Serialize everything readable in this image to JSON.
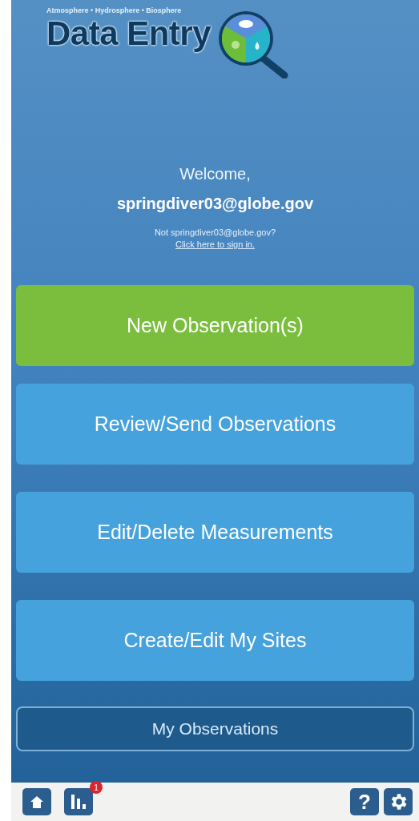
{
  "header": {
    "tagline": "Atmosphere • Hydrosphere • Biosphere",
    "title": "Data Entry"
  },
  "welcome": {
    "greeting": "Welcome,",
    "user": "springdiver03@globe.gov",
    "not_user": "Not springdiver03@globe.gov?",
    "sign_in_link": "Click here to sign in."
  },
  "actions": [
    {
      "label": "New Observation(s)",
      "kind": "primary"
    },
    {
      "label": "Review/Send Observations",
      "kind": "secondary"
    },
    {
      "label": "Edit/Delete Measurements",
      "kind": "secondary"
    },
    {
      "label": "Create/Edit My Sites",
      "kind": "secondary"
    }
  ],
  "my_observations": {
    "label": "My Observations"
  },
  "bottom_bar": {
    "stats_badge": "1",
    "help": "?"
  }
}
